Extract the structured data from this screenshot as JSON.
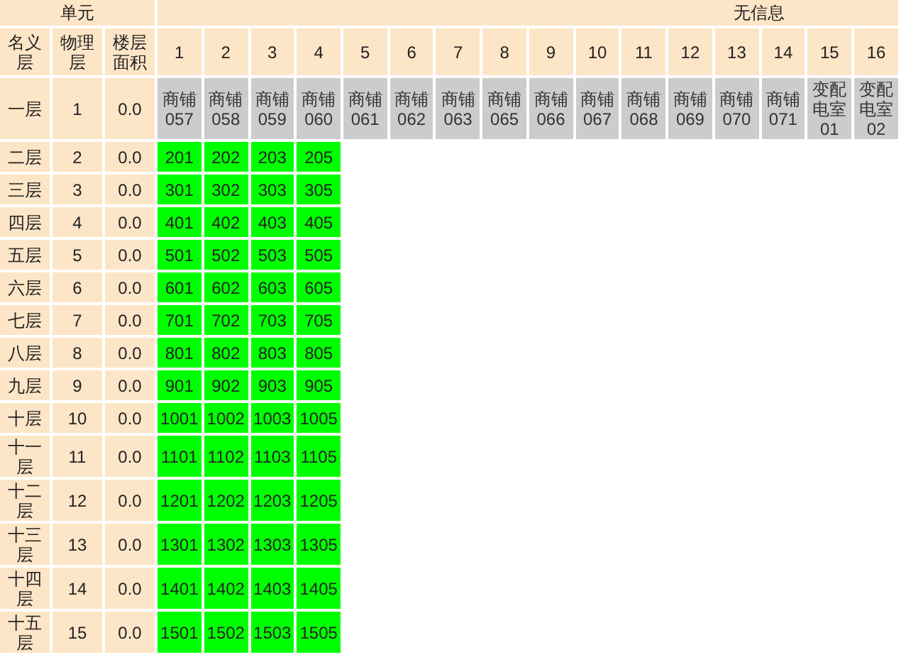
{
  "header": {
    "group_left": "单元",
    "group_right": "无信息",
    "columns": [
      "名义层",
      "物理层",
      "楼层面积"
    ],
    "units": [
      "1",
      "2",
      "3",
      "4",
      "5",
      "6",
      "7",
      "8",
      "9",
      "10",
      "11",
      "12",
      "13",
      "14",
      "15",
      "16"
    ]
  },
  "rows": [
    {
      "name": "一层",
      "physical": "1",
      "area": "0.0",
      "cells": [
        {
          "kind": "shop",
          "text": "商铺057"
        },
        {
          "kind": "shop",
          "text": "商铺058"
        },
        {
          "kind": "shop",
          "text": "商铺059"
        },
        {
          "kind": "shop",
          "text": "商铺060"
        },
        {
          "kind": "shop",
          "text": "商铺061"
        },
        {
          "kind": "shop",
          "text": "商铺062"
        },
        {
          "kind": "shop",
          "text": "商铺063"
        },
        {
          "kind": "shop",
          "text": "商铺065"
        },
        {
          "kind": "shop",
          "text": "商铺066"
        },
        {
          "kind": "shop",
          "text": "商铺067"
        },
        {
          "kind": "shop",
          "text": "商铺068"
        },
        {
          "kind": "shop",
          "text": "商铺069"
        },
        {
          "kind": "shop",
          "text": "商铺070"
        },
        {
          "kind": "shop",
          "text": "商铺071"
        },
        {
          "kind": "shop",
          "text": "变配电室01"
        },
        {
          "kind": "shop",
          "text": "变配电室02"
        }
      ]
    },
    {
      "name": "二层",
      "physical": "2",
      "area": "0.0",
      "cells": [
        {
          "kind": "unit",
          "text": "201"
        },
        {
          "kind": "unit",
          "text": "202"
        },
        {
          "kind": "unit",
          "text": "203"
        },
        {
          "kind": "unit",
          "text": "205"
        }
      ]
    },
    {
      "name": "三层",
      "physical": "3",
      "area": "0.0",
      "cells": [
        {
          "kind": "unit",
          "text": "301"
        },
        {
          "kind": "unit",
          "text": "302"
        },
        {
          "kind": "unit",
          "text": "303"
        },
        {
          "kind": "unit",
          "text": "305"
        }
      ]
    },
    {
      "name": "四层",
      "physical": "4",
      "area": "0.0",
      "cells": [
        {
          "kind": "unit",
          "text": "401"
        },
        {
          "kind": "unit",
          "text": "402"
        },
        {
          "kind": "unit",
          "text": "403"
        },
        {
          "kind": "unit",
          "text": "405"
        }
      ]
    },
    {
      "name": "五层",
      "physical": "5",
      "area": "0.0",
      "cells": [
        {
          "kind": "unit",
          "text": "501"
        },
        {
          "kind": "unit",
          "text": "502"
        },
        {
          "kind": "unit",
          "text": "503"
        },
        {
          "kind": "unit",
          "text": "505"
        }
      ]
    },
    {
      "name": "六层",
      "physical": "6",
      "area": "0.0",
      "cells": [
        {
          "kind": "unit",
          "text": "601"
        },
        {
          "kind": "unit",
          "text": "602"
        },
        {
          "kind": "unit",
          "text": "603"
        },
        {
          "kind": "unit",
          "text": "605"
        }
      ]
    },
    {
      "name": "七层",
      "physical": "7",
      "area": "0.0",
      "cells": [
        {
          "kind": "unit",
          "text": "701"
        },
        {
          "kind": "unit",
          "text": "702"
        },
        {
          "kind": "unit",
          "text": "703"
        },
        {
          "kind": "unit",
          "text": "705"
        }
      ]
    },
    {
      "name": "八层",
      "physical": "8",
      "area": "0.0",
      "cells": [
        {
          "kind": "unit",
          "text": "801"
        },
        {
          "kind": "unit",
          "text": "802"
        },
        {
          "kind": "unit",
          "text": "803"
        },
        {
          "kind": "unit",
          "text": "805"
        }
      ]
    },
    {
      "name": "九层",
      "physical": "9",
      "area": "0.0",
      "cells": [
        {
          "kind": "unit",
          "text": "901"
        },
        {
          "kind": "unit",
          "text": "902"
        },
        {
          "kind": "unit",
          "text": "903"
        },
        {
          "kind": "unit",
          "text": "905"
        }
      ]
    },
    {
      "name": "十层",
      "physical": "10",
      "area": "0.0",
      "cells": [
        {
          "kind": "unit",
          "text": "1001"
        },
        {
          "kind": "unit",
          "text": "1002"
        },
        {
          "kind": "unit",
          "text": "1003"
        },
        {
          "kind": "unit",
          "text": "1005"
        }
      ]
    },
    {
      "name": "十一层",
      "physical": "11",
      "area": "0.0",
      "cells": [
        {
          "kind": "unit",
          "text": "1101"
        },
        {
          "kind": "unit",
          "text": "1102"
        },
        {
          "kind": "unit",
          "text": "1103"
        },
        {
          "kind": "unit",
          "text": "1105"
        }
      ]
    },
    {
      "name": "十二层",
      "physical": "12",
      "area": "0.0",
      "cells": [
        {
          "kind": "unit",
          "text": "1201"
        },
        {
          "kind": "unit",
          "text": "1202"
        },
        {
          "kind": "unit",
          "text": "1203"
        },
        {
          "kind": "unit",
          "text": "1205"
        }
      ]
    },
    {
      "name": "十三层",
      "physical": "13",
      "area": "0.0",
      "cells": [
        {
          "kind": "unit",
          "text": "1301"
        },
        {
          "kind": "unit",
          "text": "1302"
        },
        {
          "kind": "unit",
          "text": "1303"
        },
        {
          "kind": "unit",
          "text": "1305"
        }
      ]
    },
    {
      "name": "十四层",
      "physical": "14",
      "area": "0.0",
      "cells": [
        {
          "kind": "unit",
          "text": "1401"
        },
        {
          "kind": "unit",
          "text": "1402"
        },
        {
          "kind": "unit",
          "text": "1403"
        },
        {
          "kind": "unit",
          "text": "1405"
        }
      ]
    },
    {
      "name": "十五层",
      "physical": "15",
      "area": "0.0",
      "cells": [
        {
          "kind": "unit",
          "text": "1501"
        },
        {
          "kind": "unit",
          "text": "1502"
        },
        {
          "kind": "unit",
          "text": "1503"
        },
        {
          "kind": "unit",
          "text": "1505"
        }
      ]
    }
  ]
}
